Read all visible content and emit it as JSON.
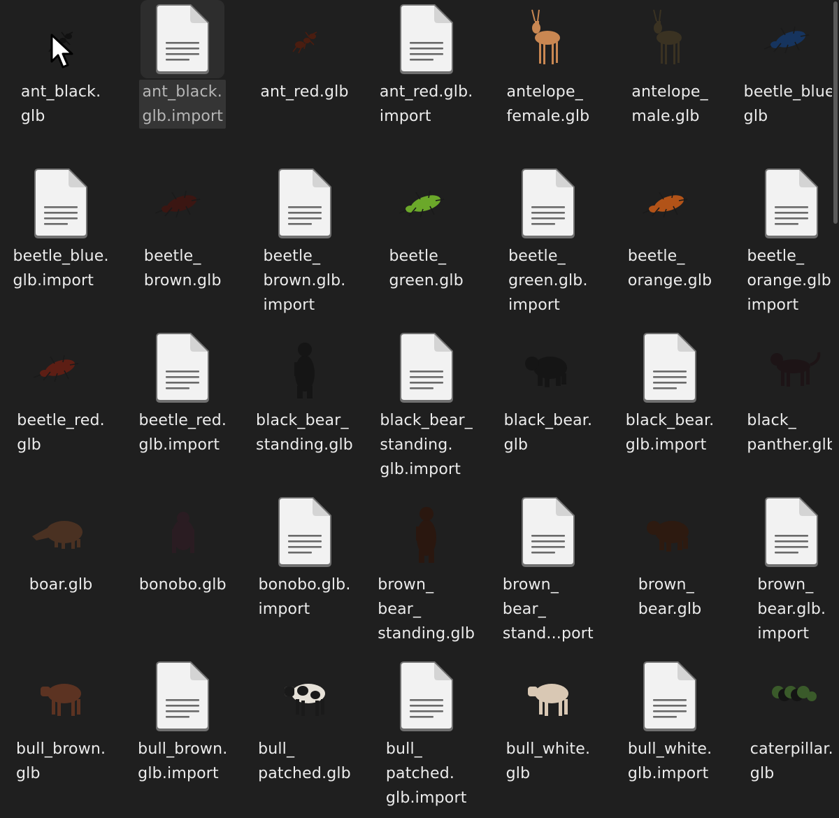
{
  "files": [
    {
      "name": "ant_black.glb",
      "lines": [
        "ant_black.",
        "glb"
      ],
      "icon": "ant-icon",
      "colors": {
        "body": "#111111"
      }
    },
    {
      "name": "ant_black.glb.import",
      "lines": [
        "ant_black.",
        "glb.import"
      ],
      "icon": "file-document-icon",
      "selected": true
    },
    {
      "name": "ant_red.glb",
      "lines": [
        "ant_red.glb"
      ],
      "icon": "ant-icon",
      "colors": {
        "body": "#4a1d10"
      }
    },
    {
      "name": "ant_red.glb.import",
      "lines": [
        "ant_red.glb.",
        "import"
      ],
      "icon": "file-document-icon"
    },
    {
      "name": "antelope_female.glb",
      "lines": [
        "antelope_",
        "female.glb"
      ],
      "icon": "antelope-icon",
      "colors": {
        "body": "#c98752"
      }
    },
    {
      "name": "antelope_male.glb",
      "lines": [
        "antelope_",
        "male.glb"
      ],
      "icon": "antelope-icon",
      "colors": {
        "body": "#3a3222"
      }
    },
    {
      "name": "beetle_blue.glb",
      "lines": [
        "beetle_blue.",
        "glb"
      ],
      "icon": "beetle-icon",
      "colors": {
        "body": "#16345e"
      }
    },
    {
      "name": "beetle_blue.glb.import",
      "lines": [
        "beetle_blue.",
        "glb.import"
      ],
      "icon": "file-document-icon"
    },
    {
      "name": "beetle_brown.glb",
      "lines": [
        "beetle_",
        "brown.glb"
      ],
      "icon": "beetle-icon",
      "colors": {
        "body": "#3b1612"
      }
    },
    {
      "name": "beetle_brown.glb.import",
      "lines": [
        "beetle_",
        "brown.glb.",
        "import"
      ],
      "icon": "file-document-icon"
    },
    {
      "name": "beetle_green.glb",
      "lines": [
        "beetle_",
        "green.glb"
      ],
      "icon": "beetle-icon",
      "colors": {
        "body": "#6ba82a"
      }
    },
    {
      "name": "beetle_green.glb.import",
      "lines": [
        "beetle_",
        "green.glb.",
        "import"
      ],
      "icon": "file-document-icon"
    },
    {
      "name": "beetle_orange.glb",
      "lines": [
        "beetle_",
        "orange.glb"
      ],
      "icon": "beetle-icon",
      "colors": {
        "body": "#b25318"
      }
    },
    {
      "name": "beetle_orange.glb.import",
      "lines": [
        "beetle_",
        "orange.glb.",
        "import"
      ],
      "icon": "file-document-icon"
    },
    {
      "name": "beetle_red.glb",
      "lines": [
        "beetle_red.",
        "glb"
      ],
      "icon": "beetle-icon",
      "colors": {
        "body": "#5d1e14"
      }
    },
    {
      "name": "beetle_red.glb.import",
      "lines": [
        "beetle_red.",
        "glb.import"
      ],
      "icon": "file-document-icon"
    },
    {
      "name": "black_bear_standing.glb",
      "lines": [
        "black_bear_",
        "standing.glb"
      ],
      "icon": "bear-standing-icon",
      "colors": {
        "body": "#151515"
      }
    },
    {
      "name": "black_bear_standing.glb.import",
      "lines": [
        "black_bear_",
        "standing.",
        "glb.import"
      ],
      "icon": "file-document-icon"
    },
    {
      "name": "black_bear.glb",
      "lines": [
        "black_bear.",
        "glb"
      ],
      "icon": "bear-icon",
      "colors": {
        "body": "#151515"
      }
    },
    {
      "name": "black_bear.glb.import",
      "lines": [
        "black_bear.",
        "glb.import"
      ],
      "icon": "file-document-icon"
    },
    {
      "name": "black_panther.glb",
      "lines": [
        "black_",
        "panther.glb"
      ],
      "icon": "panther-icon",
      "colors": {
        "body": "#1d1416"
      }
    },
    {
      "name": "boar.glb",
      "lines": [
        "boar.glb"
      ],
      "icon": "boar-icon",
      "colors": {
        "body": "#4a3122"
      }
    },
    {
      "name": "bonobo.glb",
      "lines": [
        "bonobo.glb"
      ],
      "icon": "ape-icon",
      "colors": {
        "body": "#2a1c22"
      }
    },
    {
      "name": "bonobo.glb.import",
      "lines": [
        "bonobo.glb.",
        "import"
      ],
      "icon": "file-document-icon"
    },
    {
      "name": "brown_bear_standing.glb",
      "lines": [
        "brown_",
        "bear_",
        "standing.glb"
      ],
      "icon": "bear-standing-icon",
      "colors": {
        "body": "#2a170f"
      }
    },
    {
      "name": "brown_bear_standing.glb.import",
      "lines": [
        "brown_",
        "bear_",
        "stand...port"
      ],
      "icon": "file-document-icon"
    },
    {
      "name": "brown_bear.glb",
      "lines": [
        "brown_",
        "bear.glb"
      ],
      "icon": "bear-icon",
      "colors": {
        "body": "#2d1a10"
      }
    },
    {
      "name": "brown_bear.glb.import",
      "lines": [
        "brown_",
        "bear.glb.",
        "import"
      ],
      "icon": "file-document-icon"
    },
    {
      "name": "bull_brown.glb",
      "lines": [
        "bull_brown.",
        "glb"
      ],
      "icon": "bull-icon",
      "colors": {
        "body": "#5c3322"
      }
    },
    {
      "name": "bull_brown.glb.import",
      "lines": [
        "bull_brown.",
        "glb.import"
      ],
      "icon": "file-document-icon"
    },
    {
      "name": "bull_patched.glb",
      "lines": [
        "bull_",
        "patched.glb"
      ],
      "icon": "bull-icon",
      "colors": {
        "body": "#e6e1d8",
        "patch": "#1a1a1a"
      }
    },
    {
      "name": "bull_patched.glb.import",
      "lines": [
        "bull_",
        "patched.",
        "glb.import"
      ],
      "icon": "file-document-icon"
    },
    {
      "name": "bull_white.glb",
      "lines": [
        "bull_white.",
        "glb"
      ],
      "icon": "bull-icon",
      "colors": {
        "body": "#d9c8b4"
      }
    },
    {
      "name": "bull_white.glb.import",
      "lines": [
        "bull_white.",
        "glb.import"
      ],
      "icon": "file-document-icon"
    },
    {
      "name": "caterpillar.glb",
      "lines": [
        "caterpillar.",
        "glb"
      ],
      "icon": "caterpillar-icon",
      "colors": {
        "body": "#3a5a2a",
        "stripe": "#141414"
      }
    }
  ]
}
